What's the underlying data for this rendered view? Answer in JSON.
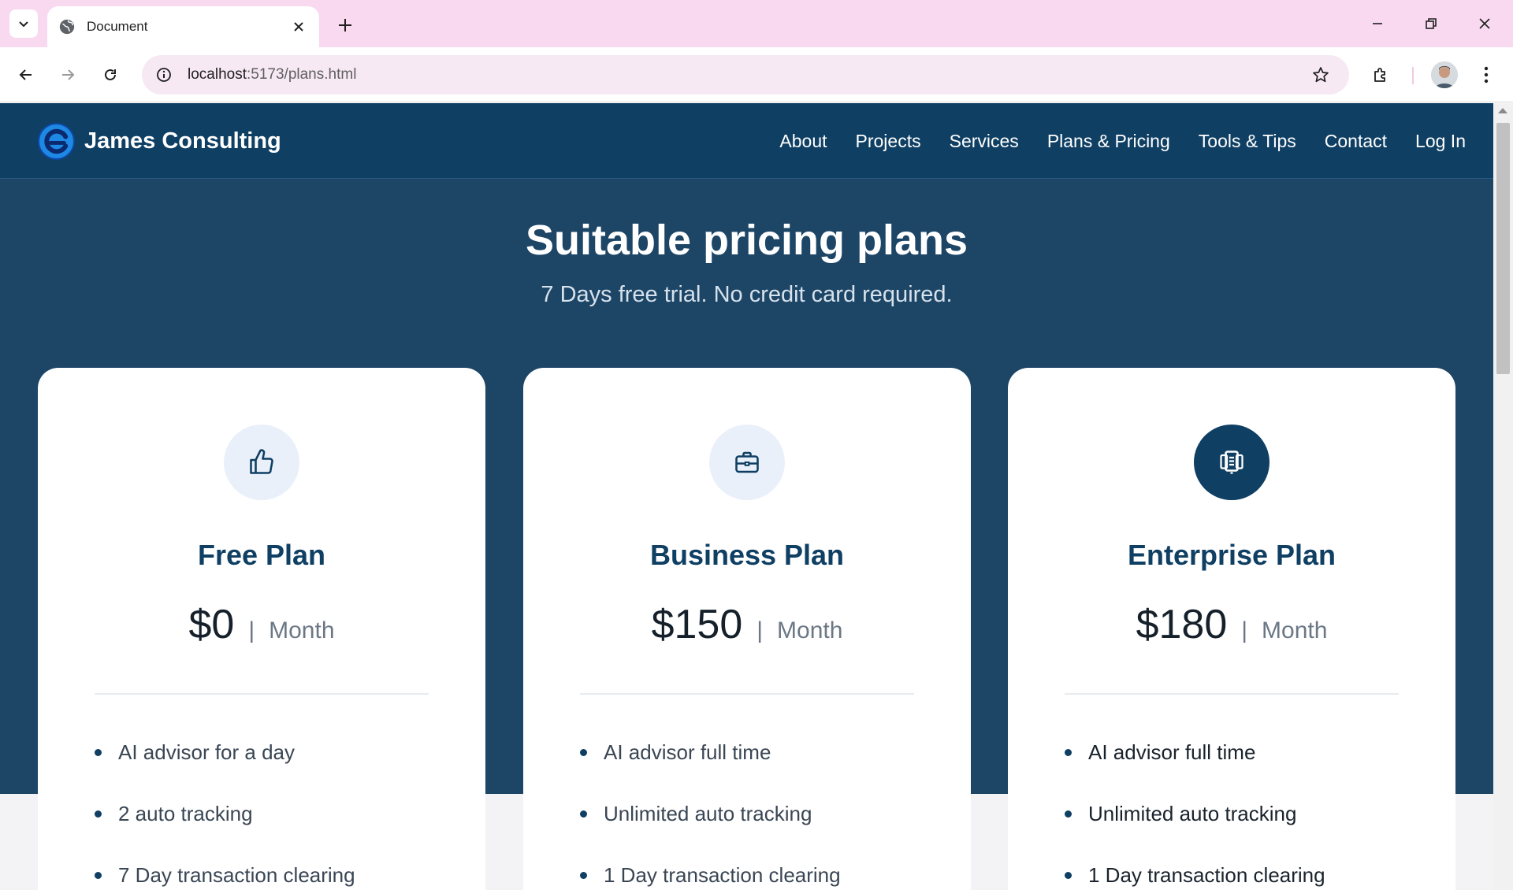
{
  "browser": {
    "tab_title": "Document",
    "url_host": "localhost",
    "url_rest": ":5173/plans.html"
  },
  "site": {
    "brand": "James Consulting",
    "nav": [
      "About",
      "Projects",
      "Services",
      "Plans & Pricing",
      "Tools & Tips",
      "Contact",
      "Log In"
    ]
  },
  "hero": {
    "title": "Suitable pricing plans",
    "subtitle": "7 Days free trial. No credit card required."
  },
  "plans": [
    {
      "name": "Free Plan",
      "price": "$0",
      "separator": "|",
      "period": "Month",
      "icon": "thumbs-up-icon",
      "features": [
        "AI advisor for a day",
        "2 auto tracking",
        "7 Day transaction clearing"
      ]
    },
    {
      "name": "Business Plan",
      "price": "$150",
      "separator": "|",
      "period": "Month",
      "icon": "briefcase-icon",
      "features": [
        "AI advisor full time",
        "Unlimited auto tracking",
        "1 Day transaction clearing"
      ]
    },
    {
      "name": "Enterprise Plan",
      "price": "$180",
      "separator": "|",
      "period": "Month",
      "icon": "devices-icon",
      "features": [
        "AI advisor full time",
        "Unlimited auto tracking",
        "1 Day transaction clearing"
      ]
    }
  ],
  "colors": {
    "header": "#0f3f63",
    "hero": "#1d4566",
    "accent": "#0f3f63",
    "tabbar": "#f8d9ef"
  }
}
